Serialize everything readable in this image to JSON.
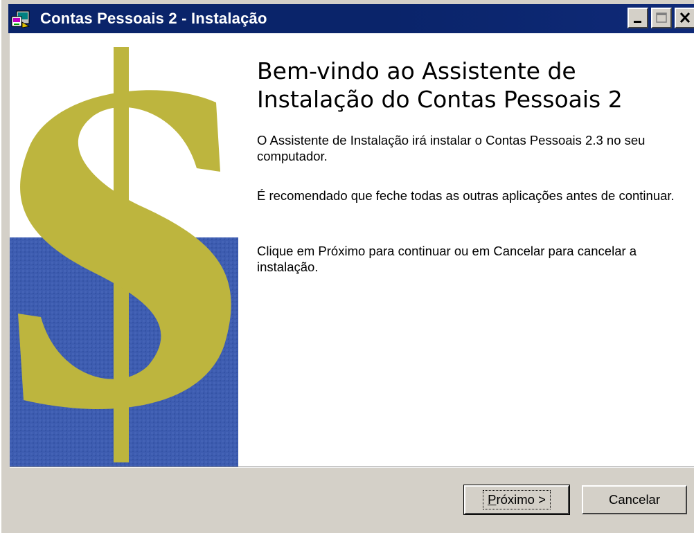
{
  "window": {
    "title": "Contas Pessoais 2 - Instalação",
    "controls": {
      "minimize_icon": "minimize-icon",
      "maximize_icon": "maximize-icon",
      "close_icon": "close-icon"
    }
  },
  "wizard": {
    "heading": "Bem-vindo ao Assistente de Instalação do Contas Pessoais 2",
    "paragraphs": [
      "O Assistente de Instalação irá instalar o Contas Pessoais 2.3 no seu computador.",
      "É recomendado que feche todas as outras aplicações antes de continuar.",
      "Clique em Próximo para continuar ou em Cancelar para cancelar a instalação."
    ],
    "banner_icon": "dollar-sign-banner"
  },
  "buttons": {
    "next_mnemonic": "P",
    "next_rest": "róximo >",
    "cancel": "Cancelar"
  },
  "colors": {
    "titlebar": "#0a246a",
    "banner_blue": "#3d5cb0",
    "banner_gold": "#bdb53e",
    "dialog_face": "#d4d0c8"
  }
}
